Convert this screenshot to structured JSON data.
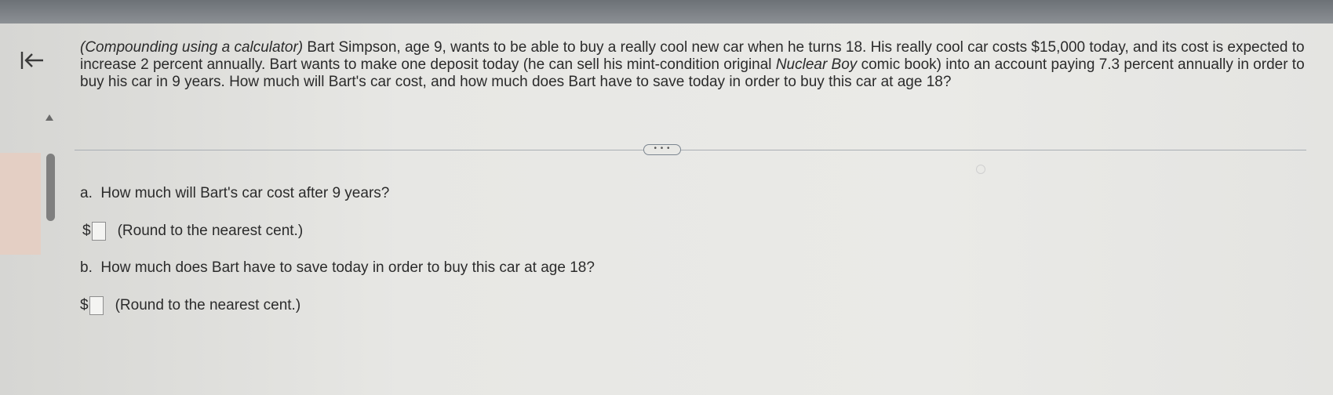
{
  "question": {
    "lead_italic": "(Compounding using a calculator)",
    "text_part1": " Bart Simpson, age 9, wants to be able to buy a really cool new car when he turns 18.  His really cool car costs $15,000 today, and its cost is expected to increase 2 percent annually.  Bart wants to make one deposit today (he can sell his mint-condition original ",
    "comic_italic": "Nuclear Boy",
    "text_part2": " comic book) into an account paying 7.3 percent annually in order to buy his car in 9 years.  How much will Bart's car cost, and how much does Bart have to save today in order to buy this car at age 18?"
  },
  "divider": {
    "expand_label": "• • •"
  },
  "parts": [
    {
      "label": "a.",
      "prompt": "How much will Bart's car cost after 9 years?",
      "currency": "$",
      "value": "",
      "hint": "(Round to the nearest cent.)"
    },
    {
      "label": "b.",
      "prompt": "How much does Bart have to save today in order to buy this car at age 18?",
      "currency": "$",
      "value": "",
      "hint": "(Round to the nearest cent.)"
    }
  ],
  "icons": {
    "back": "back-to-start-icon",
    "collapse": "triangle-up-icon"
  },
  "colors": {
    "text": "#2b2b2b",
    "divider": "#a9aeb4",
    "scrollbar": "#7f7f7f",
    "accent_panel": "#e4cfc4"
  }
}
